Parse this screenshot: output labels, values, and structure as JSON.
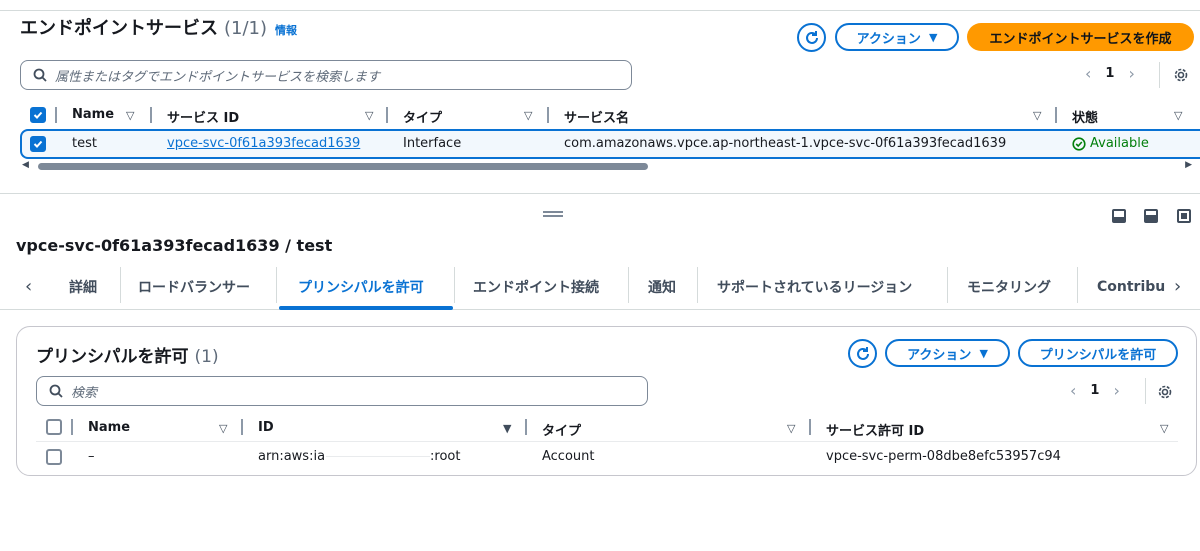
{
  "top": {
    "title": "エンドポイントサービス",
    "count": "(1/1)",
    "info": "情報",
    "actions_label": "アクション",
    "create_label": "エンドポイントサービスを作成",
    "search_placeholder": "属性またはタグでエンドポイントサービスを検索します",
    "page": "1",
    "columns": [
      "Name",
      "サービス ID",
      "タイプ",
      "サービス名",
      "状態"
    ],
    "row": {
      "name": "test",
      "service_id": "vpce-svc-0f61a393fecad1639",
      "type": "Interface",
      "service_name": "com.amazonaws.vpce.ap-northeast-1.vpce-svc-0f61a393fecad1639",
      "status": "Available"
    }
  },
  "detail": {
    "title": "vpce-svc-0f61a393fecad1639 / test",
    "tabs": [
      "詳細",
      "ロードバランサー",
      "プリンシパルを許可",
      "エンドポイント接続",
      "通知",
      "サポートされているリージョン",
      "モニタリング",
      "Contribut"
    ],
    "active_tab": "プリンシパルを許可"
  },
  "principals": {
    "title": "プリンシパルを許可",
    "count": "(1)",
    "actions_label": "アクション",
    "allow_label": "プリンシパルを許可",
    "search_placeholder": "検索",
    "page": "1",
    "columns": [
      "Name",
      "ID",
      "タイプ",
      "サービス許可 ID"
    ],
    "row": {
      "name": "–",
      "id_prefix": "arn:aws:ia",
      "id_suffix": ":root",
      "type": "Account",
      "permission_id": "vpce-svc-perm-08dbe8efc53957c94"
    }
  },
  "colors": {
    "accent": "#0972d3",
    "primary": "#ff9900",
    "success": "#037f0c"
  }
}
